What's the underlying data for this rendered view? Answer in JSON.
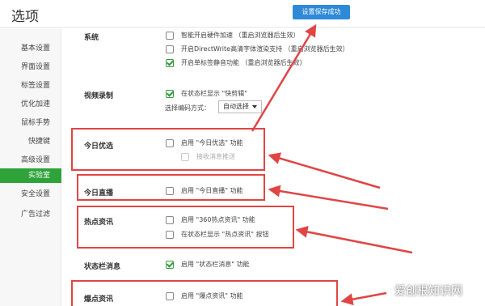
{
  "header": {
    "title": "选项",
    "toast": "设置保存成功"
  },
  "sidebar": {
    "items": [
      {
        "label": "基本设置"
      },
      {
        "label": "界面设置"
      },
      {
        "label": "标签设置"
      },
      {
        "label": "优化加速"
      },
      {
        "label": "鼠标手势"
      },
      {
        "label": "快捷键"
      },
      {
        "label": "高级设置"
      },
      {
        "label": "实验室",
        "active": true
      },
      {
        "label": "安全设置"
      },
      {
        "label": "广告过滤"
      }
    ]
  },
  "sections": {
    "system": {
      "label": "系统",
      "options": [
        {
          "text": "智能开启硬件加速 （重启浏览器后生效）",
          "checked": false
        },
        {
          "text": "开启DirectWrite高清字体渲染支持 （重启浏览器后生效）",
          "checked": false
        },
        {
          "text": "开启单标签静音功能 （重启浏览器后生效）",
          "checked": true
        }
      ]
    },
    "video": {
      "label": "视频录制",
      "options": [
        {
          "text": "在状态栏显示 \"快剪辑\"",
          "checked": true
        }
      ],
      "encode_label": "选择编码方式：",
      "encode_value": "自动选择"
    },
    "today_pick": {
      "label": "今日优选",
      "options": [
        {
          "text": "启用 \"今日优选\" 功能",
          "checked": false
        },
        {
          "text": "接收消息推送",
          "checked": false,
          "disabled": true
        }
      ]
    },
    "today_live": {
      "label": "今日直播",
      "options": [
        {
          "text": "启用 \"今日直播\" 功能",
          "checked": false
        }
      ]
    },
    "hot_news": {
      "label": "热点资讯",
      "options": [
        {
          "text": "启用 \"360热点资讯\" 功能",
          "checked": false
        },
        {
          "text": "在状态栏显示 \"热点资讯\" 按钮",
          "checked": false
        }
      ]
    },
    "status_msg": {
      "label": "状态栏消息",
      "options": [
        {
          "text": "启用 \"状态栏消息\" 功能",
          "checked": true
        }
      ]
    },
    "breaking_news": {
      "label": "爆点资讯",
      "options": [
        {
          "text": "启用 \"爆点资讯\" 功能",
          "checked": false
        }
      ]
    }
  },
  "watermark": "爱创根知识网",
  "colors": {
    "accent_green": "#2fa33a",
    "toast_blue": "#2e8ad8",
    "annotation_red": "#e04545"
  }
}
